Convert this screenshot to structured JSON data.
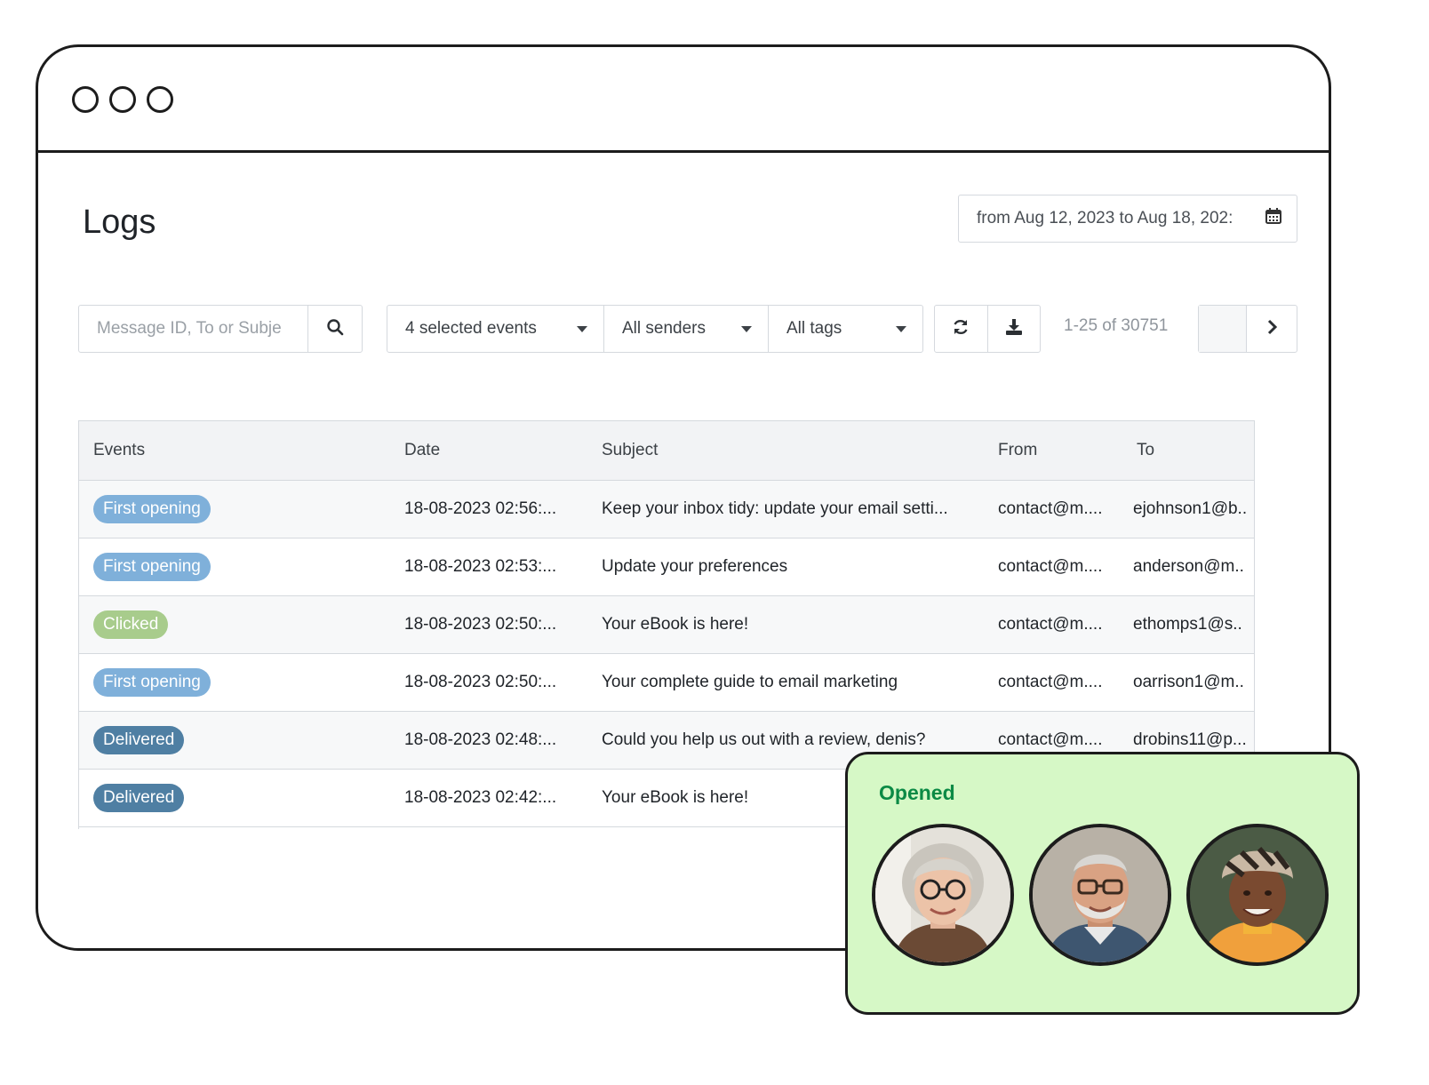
{
  "window": {
    "controls": [
      "window-dot-1",
      "window-dot-2",
      "window-dot-3"
    ]
  },
  "page": {
    "title": "Logs"
  },
  "date_filter": {
    "label": "from Aug 12, 2023 to Aug 18, 202:",
    "icon": "calendar-icon"
  },
  "search": {
    "placeholder": "Message ID, To or Subje",
    "icon": "search-icon"
  },
  "filters": {
    "events": "4 selected events",
    "senders": "All senders",
    "tags": "All tags"
  },
  "actions": {
    "refresh_icon": "refresh-icon",
    "download_icon": "download-icon"
  },
  "pagination": {
    "range": "1-25 of 30751",
    "next_icon": "chevron-right-icon"
  },
  "table": {
    "headers": {
      "events": "Events",
      "date": "Date",
      "subject": "Subject",
      "from": "From",
      "to": "To"
    },
    "rows": [
      {
        "event": "First opening",
        "event_color": "#7fb0da",
        "date": "18-08-2023 02:56:...",
        "subject": "Keep your inbox tidy: update your email setti...",
        "from": "contact@m....",
        "to": "ejohnson1@b.."
      },
      {
        "event": "First opening",
        "event_color": "#7fb0da",
        "date": "18-08-2023 02:53:...",
        "subject": "Update your preferences",
        "from": "contact@m....",
        "to": "anderson@m.."
      },
      {
        "event": "Clicked",
        "event_color": "#a8cc8c",
        "date": "18-08-2023 02:50:...",
        "subject": "Your eBook is here!",
        "from": "contact@m....",
        "to": "ethomps1@s.."
      },
      {
        "event": "First opening",
        "event_color": "#7fb0da",
        "date": "18-08-2023 02:50:...",
        "subject": "Your complete guide to email marketing",
        "from": "contact@m....",
        "to": "oarrison1@m.."
      },
      {
        "event": "Delivered",
        "event_color": "#4f7fa3",
        "date": "18-08-2023 02:48:...",
        "subject": "Could you help us out with a review, denis?",
        "from": "contact@m....",
        "to": "drobins11@p..."
      },
      {
        "event": "Delivered",
        "event_color": "#4f7fa3",
        "date": "18-08-2023 02:42:...",
        "subject": "Your eBook is here!",
        "from": "",
        "to": ""
      }
    ]
  },
  "opened_card": {
    "title": "Opened",
    "avatars": [
      "avatar-woman-glasses",
      "avatar-man-glasses",
      "avatar-woman-headwrap"
    ]
  },
  "colors": {
    "accent_green": "#0b8a45",
    "card_bg": "#d6f8c6",
    "border": "#1c1c1c"
  }
}
